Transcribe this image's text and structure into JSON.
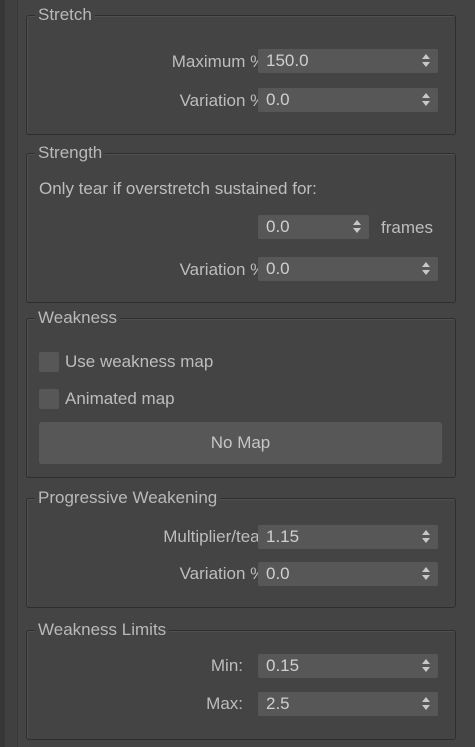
{
  "stretch": {
    "title": "Stretch",
    "maximum": {
      "label": "Maximum %:",
      "value": "150.0"
    },
    "variation": {
      "label": "Variation %:",
      "value": "0.0"
    }
  },
  "strength": {
    "title": "Strength",
    "description": "Only tear if overstretch sustained for:",
    "frames": {
      "value": "0.0",
      "unit": "frames"
    },
    "variation": {
      "label": "Variation %:",
      "value": "0.0"
    }
  },
  "weakness": {
    "title": "Weakness",
    "use_map": {
      "label": "Use weakness map",
      "checked": false
    },
    "animated_map": {
      "label": "Animated map",
      "checked": false
    },
    "map_button": "No Map"
  },
  "progressive": {
    "title": "Progressive Weakening",
    "multiplier": {
      "label": "Multiplier/tear:",
      "value": "1.15"
    },
    "variation": {
      "label": "Variation %:",
      "value": "0.0"
    }
  },
  "limits": {
    "title": "Weakness Limits",
    "min": {
      "label": "Min:",
      "value": "0.15"
    },
    "max": {
      "label": "Max:",
      "value": "2.5"
    }
  }
}
